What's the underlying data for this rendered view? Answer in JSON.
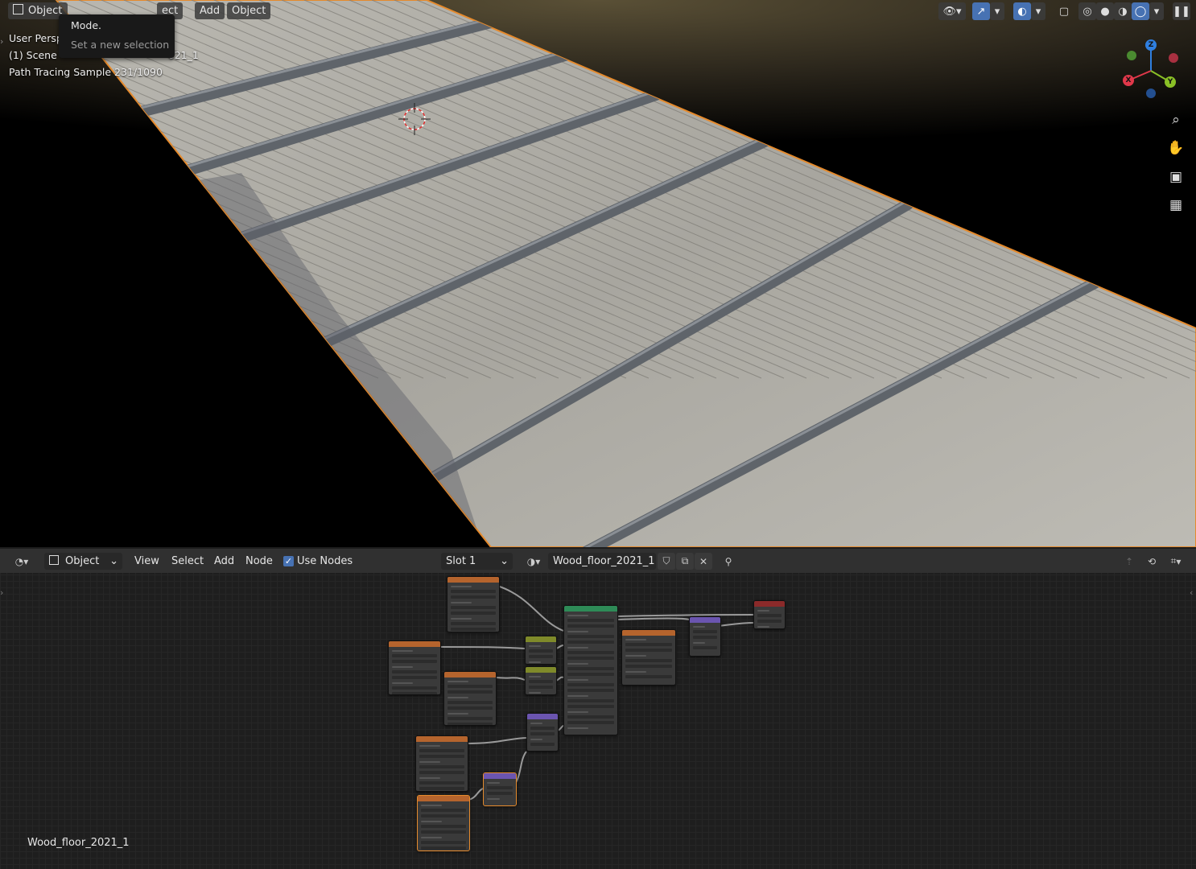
{
  "viewport": {
    "header": {
      "mode_label": "Object",
      "menus": [
        "ect",
        "Add",
        "Object"
      ]
    },
    "tooltip": {
      "title": "Mode.",
      "description": "Set a new selection"
    },
    "overlay": {
      "view_name": "User Perspe",
      "scene_object_left": "(1) Scene",
      "scene_object_right": "021_1",
      "render_status": "Path Tracing Sample 231/1090"
    },
    "gizmo": {
      "axes": [
        "Z",
        "X",
        "Y"
      ]
    },
    "nav_icons": [
      "zoom-icon",
      "hand-pan-icon",
      "camera-icon",
      "grid-ortho-icon"
    ]
  },
  "node_editor": {
    "header": {
      "editor_type_icon": "shader-editor-icon",
      "object_mode": "Object",
      "menus": [
        "View",
        "Select",
        "Add",
        "Node"
      ],
      "use_nodes_label": "Use Nodes",
      "use_nodes_checked": true,
      "slot": "Slot 1",
      "material_name": "Wood_floor_2021_1"
    },
    "footer_label": "Wood_floor_2021_1"
  },
  "colors": {
    "accent_blue": "#4772b3",
    "selection_orange": "#e58a2c",
    "node_header_texture": "#b5642d",
    "node_header_shader": "#2e8b57",
    "node_header_vector": "#6b55b0",
    "node_header_output": "#8b2a2a",
    "node_header_converter": "#7f8a2a"
  }
}
